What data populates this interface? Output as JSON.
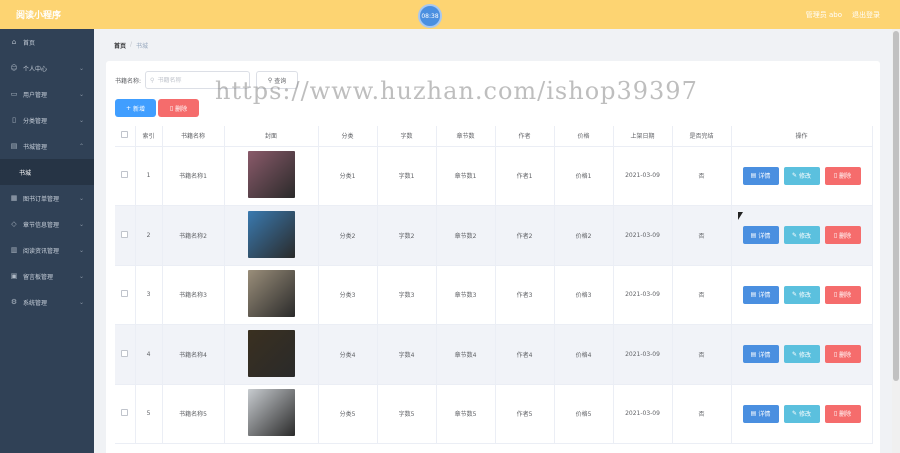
{
  "header": {
    "title": "阅读小程序",
    "clock": "08:38",
    "admin": "管理员 abo",
    "logout": "退出登录"
  },
  "sidebar": {
    "items": [
      {
        "label": "首页",
        "icon": "home-icon",
        "expandable": false
      },
      {
        "label": "个人中心",
        "icon": "user-icon",
        "expandable": true
      },
      {
        "label": "用户管理",
        "icon": "folder-icon",
        "expandable": true
      },
      {
        "label": "分类管理",
        "icon": "file-icon",
        "expandable": true
      },
      {
        "label": "书城管理",
        "icon": "book-icon",
        "expandable": true
      },
      {
        "label": "图书订单管理",
        "icon": "order-icon",
        "expandable": true
      },
      {
        "label": "章节信息管理",
        "icon": "chapter-icon",
        "expandable": true
      },
      {
        "label": "阅读资讯管理",
        "icon": "news-icon",
        "expandable": true
      },
      {
        "label": "留言板管理",
        "icon": "message-icon",
        "expandable": true
      },
      {
        "label": "系统管理",
        "icon": "gear-icon",
        "expandable": true
      }
    ],
    "submenu": "书城"
  },
  "breadcrumb": {
    "home": "首页",
    "sep": "/",
    "current": "书城"
  },
  "search": {
    "label": "书籍名称:",
    "placeholder": "书籍名称",
    "query_label": "查询"
  },
  "actions": {
    "add": "新增",
    "delete": "删除"
  },
  "table": {
    "headers": [
      "",
      "索引",
      "书籍名称",
      "封面",
      "分类",
      "字数",
      "章节数",
      "作者",
      "价格",
      "上架日期",
      "是否完结",
      "操作"
    ],
    "rows": [
      {
        "index": "1",
        "name": "书籍名称1",
        "category": "分类1",
        "words": "字数1",
        "chapters": "章节数1",
        "author": "作者1",
        "price": "价格1",
        "date": "2021-03-09",
        "finished": "否",
        "cover_color": "#8a5a6a"
      },
      {
        "index": "2",
        "name": "书籍名称2",
        "category": "分类2",
        "words": "字数2",
        "chapters": "章节数2",
        "author": "作者2",
        "price": "价格2",
        "date": "2021-03-09",
        "finished": "否",
        "cover_color": "#3a7ab0"
      },
      {
        "index": "3",
        "name": "书籍名称3",
        "category": "分类3",
        "words": "字数3",
        "chapters": "章节数3",
        "author": "作者3",
        "price": "价格3",
        "date": "2021-03-09",
        "finished": "否",
        "cover_color": "#9a8e7a"
      },
      {
        "index": "4",
        "name": "书籍名称4",
        "category": "分类4",
        "words": "字数4",
        "chapters": "章节数4",
        "author": "作者4",
        "price": "价格4",
        "date": "2021-03-09",
        "finished": "否",
        "cover_color": "#3a3020"
      },
      {
        "index": "5",
        "name": "书籍名称5",
        "category": "分类5",
        "words": "字数5",
        "chapters": "章节数5",
        "author": "作者5",
        "price": "价格5",
        "date": "2021-03-09",
        "finished": "否",
        "cover_color": "#c8ccd0"
      }
    ],
    "ops": {
      "detail": "详情",
      "edit": "修改",
      "delete": "删除"
    }
  },
  "watermark": "https://www.huzhan.com/ishop39397",
  "colors": {
    "header": "#fdd472",
    "sidebar": "#304156",
    "primary": "#409eff",
    "danger": "#f56c6c",
    "info": "#5bc0de"
  }
}
